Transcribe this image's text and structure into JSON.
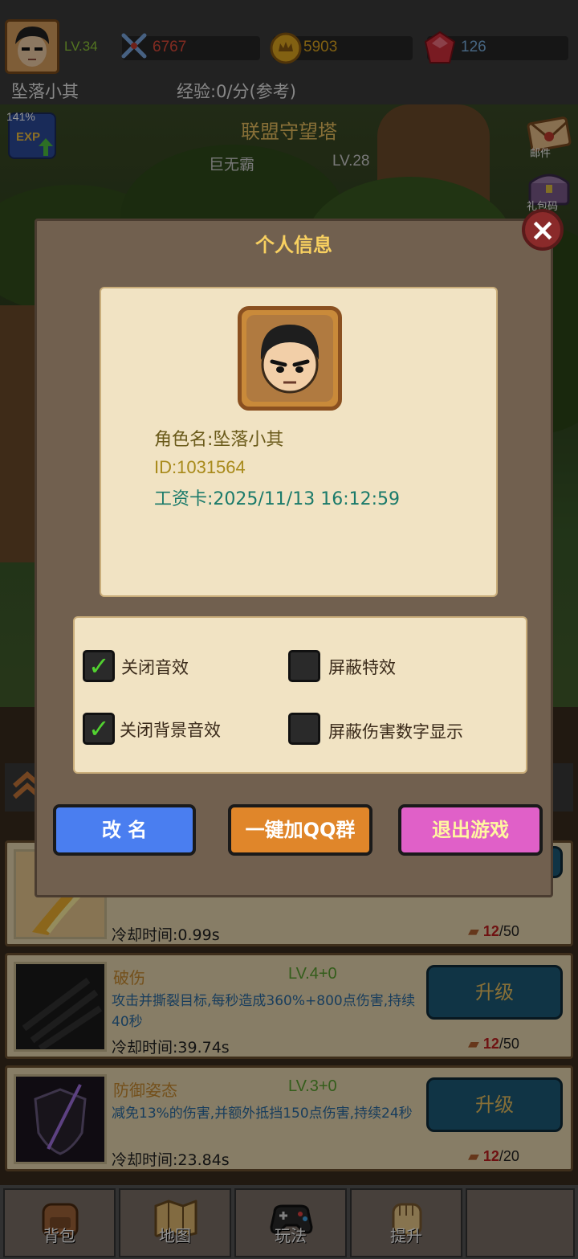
{
  "player": {
    "level": "LV.34",
    "combat_power": "6767",
    "gold": "5903",
    "gems": "126",
    "name": "坠落小其",
    "exp_rate": "经验:0/分(参考)"
  },
  "exp_boost": {
    "percent": "141%",
    "label": "EXP"
  },
  "stage": {
    "title": "联盟守望塔",
    "boss_name": "巨无霸",
    "boss_level": "LV.28"
  },
  "side_menu": {
    "mail_label": "邮件",
    "gift_code_label": "礼包码"
  },
  "skills": [
    {
      "name": "",
      "level": "",
      "description": "",
      "cooldown": "冷却时间:0.99s",
      "cost_current": "12",
      "cost_total": "/50",
      "button": ""
    },
    {
      "name": "破伤",
      "level": "LV.4+0",
      "description": "攻击并撕裂目标,每秒造成360%+800点伤害,持续40秒",
      "cooldown": "冷却时间:39.74s",
      "cost_current": "12",
      "cost_total": "/50",
      "button": "升级"
    },
    {
      "name": "防御姿态",
      "level": "LV.3+0",
      "description": "减免13%的伤害,并额外抵挡150点伤害,持续24秒",
      "cooldown": "冷却时间:23.84s",
      "cost_current": "12",
      "cost_total": "/20",
      "button": "升级"
    }
  ],
  "bottom_nav": [
    {
      "label": "背包",
      "icon": "backpack-icon"
    },
    {
      "label": "地图",
      "icon": "map-icon"
    },
    {
      "label": "玩法",
      "icon": "gamepad-icon"
    },
    {
      "label": "提升",
      "icon": "fist-icon"
    },
    {
      "label": "",
      "icon": ""
    }
  ],
  "modal": {
    "title": "个人信息",
    "close_icon": "close-icon",
    "role_name": "角色名:坠落小其",
    "id": "ID:1031564",
    "salary_card": "工资卡:2025/11/13 16:12:59",
    "options": [
      {
        "label": "关闭音效",
        "checked": true
      },
      {
        "label": "屏蔽特效",
        "checked": false
      },
      {
        "label": "关闭背景音效",
        "checked": true
      },
      {
        "label": "屏蔽伤害数字显示",
        "checked": false
      }
    ],
    "buttons": {
      "rename": "改 名",
      "join_qq": "一键加QQ群",
      "exit": "退出游戏"
    }
  },
  "colors": {
    "accent_gold": "#f8d060",
    "rename_btn": "#4a7ef0",
    "qq_btn": "#e0862a",
    "exit_btn": "#e060c8",
    "check_green": "#52d230"
  }
}
